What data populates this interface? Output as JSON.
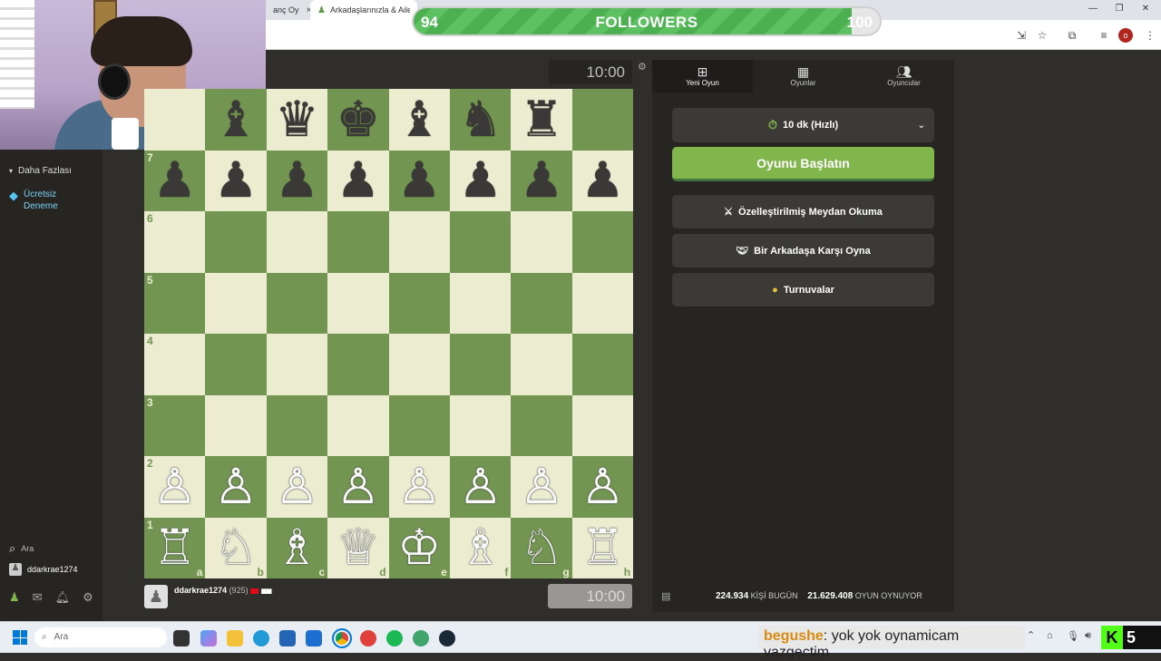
{
  "browser": {
    "tabs": [
      {
        "label": "anç Oy",
        "active": false
      },
      {
        "label": "Arkadaşlarınızla & Ailenizle",
        "active": true
      }
    ],
    "close_glyph": "×"
  },
  "followers": {
    "current": "94",
    "goal": "100",
    "label": "FOLLOWERS",
    "progress": 0.94
  },
  "sidebar": {
    "items": [
      {
        "label": "Daha Fazlası"
      },
      {
        "label": "Ücretsiz"
      },
      {
        "label": "Deneme"
      }
    ],
    "search_label": "Ara",
    "username": "ddarkrae1274"
  },
  "board": {
    "rows": [
      [
        "",
        "b♝",
        "b♛",
        "b♚",
        "b♝",
        "b♞",
        "b♜",
        ""
      ],
      [
        "b♟",
        "b♟",
        "b♟",
        "b♟",
        "b♟",
        "b♟",
        "b♟",
        "b♟"
      ],
      [
        "",
        "",
        "",
        "",
        "",
        "",
        "",
        ""
      ],
      [
        "",
        "",
        "",
        "",
        "",
        "",
        "",
        ""
      ],
      [
        "",
        "",
        "",
        "",
        "",
        "",
        "",
        ""
      ],
      [
        "",
        "",
        "",
        "",
        "",
        "",
        "",
        ""
      ],
      [
        "w♙",
        "w♙",
        "w♙",
        "w♙",
        "w♙",
        "w♙",
        "w♙",
        "w♙"
      ],
      [
        "w♖",
        "w♘",
        "w♗",
        "w♕",
        "w♔",
        "w♗",
        "w♘",
        "w♖"
      ]
    ],
    "ranks": [
      "",
      "7",
      "6",
      "5",
      "4",
      "3",
      "2",
      "1"
    ],
    "files": [
      "a",
      "b",
      "c",
      "d",
      "e",
      "f",
      "g",
      "h"
    ]
  },
  "clocks": {
    "top": "10:00",
    "bottom": "10:00"
  },
  "player": {
    "name": "ddarkrae1274",
    "rating": "(925)"
  },
  "panel": {
    "tabs": [
      {
        "label": "Yeni Oyun",
        "icon": "plus-square-icon"
      },
      {
        "label": "Oyunlar",
        "icon": "board-icon"
      },
      {
        "label": "Oyuncular",
        "icon": "players-icon"
      }
    ],
    "time_control": "10 dk (Hızlı)",
    "start_label": "Oyunu Başlatın",
    "options": [
      {
        "label": "Özelleştirilmiş Meydan Okuma",
        "icon": "custom-challenge-icon"
      },
      {
        "label": "Bir Arkadaşa Karşı Oyna",
        "icon": "handshake-icon"
      },
      {
        "label": "Turnuvalar",
        "icon": "medal-icon"
      }
    ],
    "stats": {
      "today_count": "224.934",
      "today_label": "KİŞİ BUGÜN",
      "playing_count": "21.629.408",
      "playing_label": "OYUN OYNUYOR"
    }
  },
  "taskbar": {
    "search_label": "Ara",
    "chat_user": "begushe",
    "chat_message": ": yok yok oynamicam vazgectim",
    "badge_count": "5"
  },
  "colors": {
    "board_light": "#ebecd0",
    "board_dark": "#739552",
    "accent_green": "#81b64c"
  }
}
